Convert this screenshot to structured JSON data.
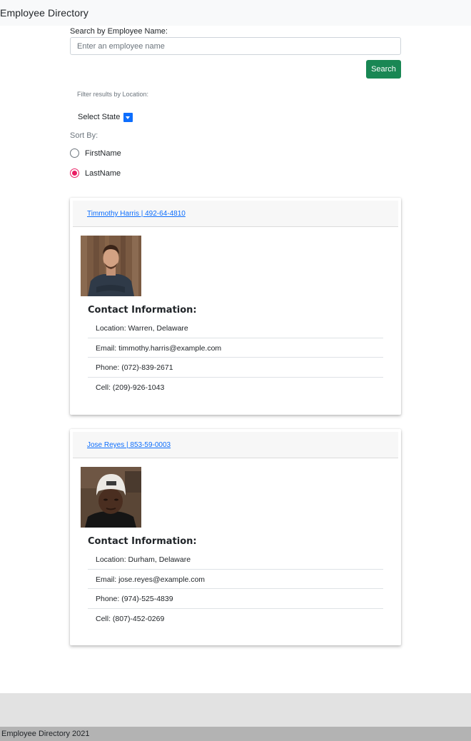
{
  "navbar": {
    "brand": "Employee Directory"
  },
  "search": {
    "label": "Search by Employee Name:",
    "placeholder": "Enter an employee name",
    "value": "",
    "button_label": "Search"
  },
  "filter": {
    "label": "Filter results by Location:",
    "state_select": "Select State"
  },
  "sort": {
    "label": "Sort By:",
    "options": [
      {
        "label": "FirstName",
        "checked": false
      },
      {
        "label": "LastName",
        "checked": true
      }
    ]
  },
  "employees": [
    {
      "header_link": "Timmothy Harris | 492-64-4810",
      "contact_heading": "Contact Information:",
      "location": "Location: Warren, Delaware",
      "email": "Email: timmothy.harris@example.com",
      "phone": "Phone: (072)-839-2671",
      "cell": "Cell: (209)-926-1043"
    },
    {
      "header_link": "Jose Reyes | 853-59-0003",
      "contact_heading": "Contact Information:",
      "location": "Location: Durham, Delaware",
      "email": "Email: jose.reyes@example.com",
      "phone": "Phone: (974)-525-4839",
      "cell": "Cell: (807)-452-0269"
    }
  ],
  "footer": {
    "text": "Employee Directory 2021"
  },
  "colors": {
    "primary_button": "#198754",
    "link": "#0d6efd",
    "radio_checked": "#e91e63"
  }
}
